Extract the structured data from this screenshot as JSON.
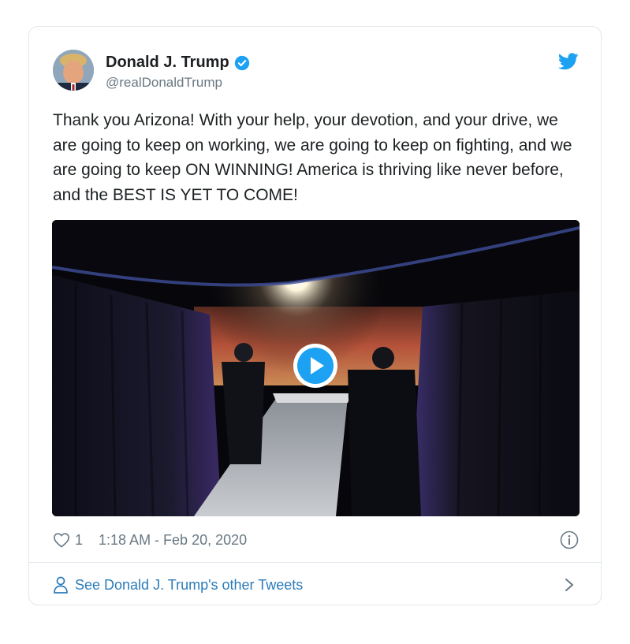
{
  "author": {
    "name": "Donald J. Trump",
    "handle": "@realDonaldTrump"
  },
  "tweet": {
    "text": "Thank you Arizona! With your help, your devotion, and your drive, we are going to keep on working, we are going to keep on fighting, and we are going to keep ON WINNING! America is thriving like never before, and the BEST IS YET TO COME!"
  },
  "meta": {
    "likes": "1",
    "timestamp": "1:18 AM - Feb 20, 2020"
  },
  "footer": {
    "label": "See Donald J. Trump's other Tweets"
  },
  "icons": {
    "verified": "verified-badge-icon",
    "twitter": "twitter-bird-icon",
    "play": "play-icon",
    "heart": "heart-icon",
    "info": "info-icon",
    "person": "person-icon",
    "chevron": "chevron-right-icon"
  },
  "colors": {
    "accent": "#1da1f2",
    "link": "#2b7bb9",
    "muted": "#697882",
    "border": "#e1e8ed",
    "text": "#1c2022"
  }
}
